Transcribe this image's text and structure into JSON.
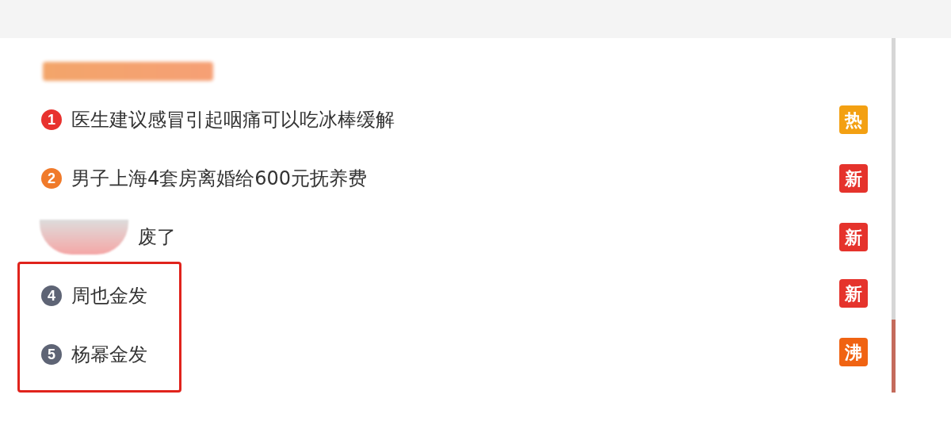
{
  "heading": {
    "blurred": true
  },
  "items": [
    {
      "rank": "1",
      "color": "#e8322e",
      "title": "医生建议感冒引起咽痛可以吃冰棒缓解",
      "tag": {
        "text": "热",
        "color": "#f3a012"
      },
      "obscured": false,
      "highlighted": false
    },
    {
      "rank": "2",
      "color": "#f07a2a",
      "title": "男子上海4套房离婚给600元抚养费",
      "tag": {
        "text": "新",
        "color": "#e5332c"
      },
      "obscured": false,
      "highlighted": false
    },
    {
      "title": "废了",
      "tag": {
        "text": "新",
        "color": "#e5332c"
      },
      "obscured": true,
      "highlighted": false
    },
    {
      "rank": "4",
      "color": "#5e6475",
      "title": "周也金发",
      "tag": {
        "text": "新",
        "color": "#e5332c"
      },
      "obscured": false,
      "highlighted": true
    },
    {
      "rank": "5",
      "color": "#5e6475",
      "title": "杨幂金发",
      "tag": {
        "text": "沸",
        "color": "#f06312"
      },
      "obscured": false,
      "highlighted": true
    }
  ]
}
